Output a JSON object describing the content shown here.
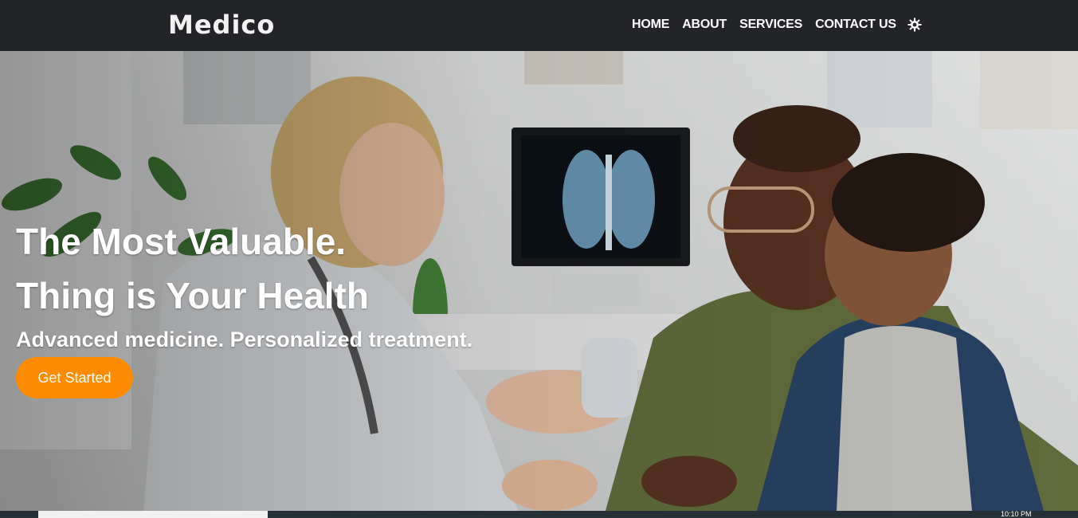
{
  "navbar": {
    "brand": "Medico",
    "links": [
      "HOME",
      "ABOUT",
      "SERVICES",
      "CONTACT US"
    ],
    "theme_icon": "sun-gear-icon"
  },
  "hero": {
    "title_line_1": "The Most Valuable.",
    "title_line_2": "Thing is Your Health",
    "subtitle": "Advanced medicine. Personalized treatment.",
    "cta_label": "Get Started",
    "background": "doctor-patient-photo"
  },
  "colors": {
    "navbar_bg": "#232428",
    "cta_bg": "#ff8c00",
    "text": "#ffffff"
  },
  "taskbar": {
    "clock": "10:10 PM"
  }
}
